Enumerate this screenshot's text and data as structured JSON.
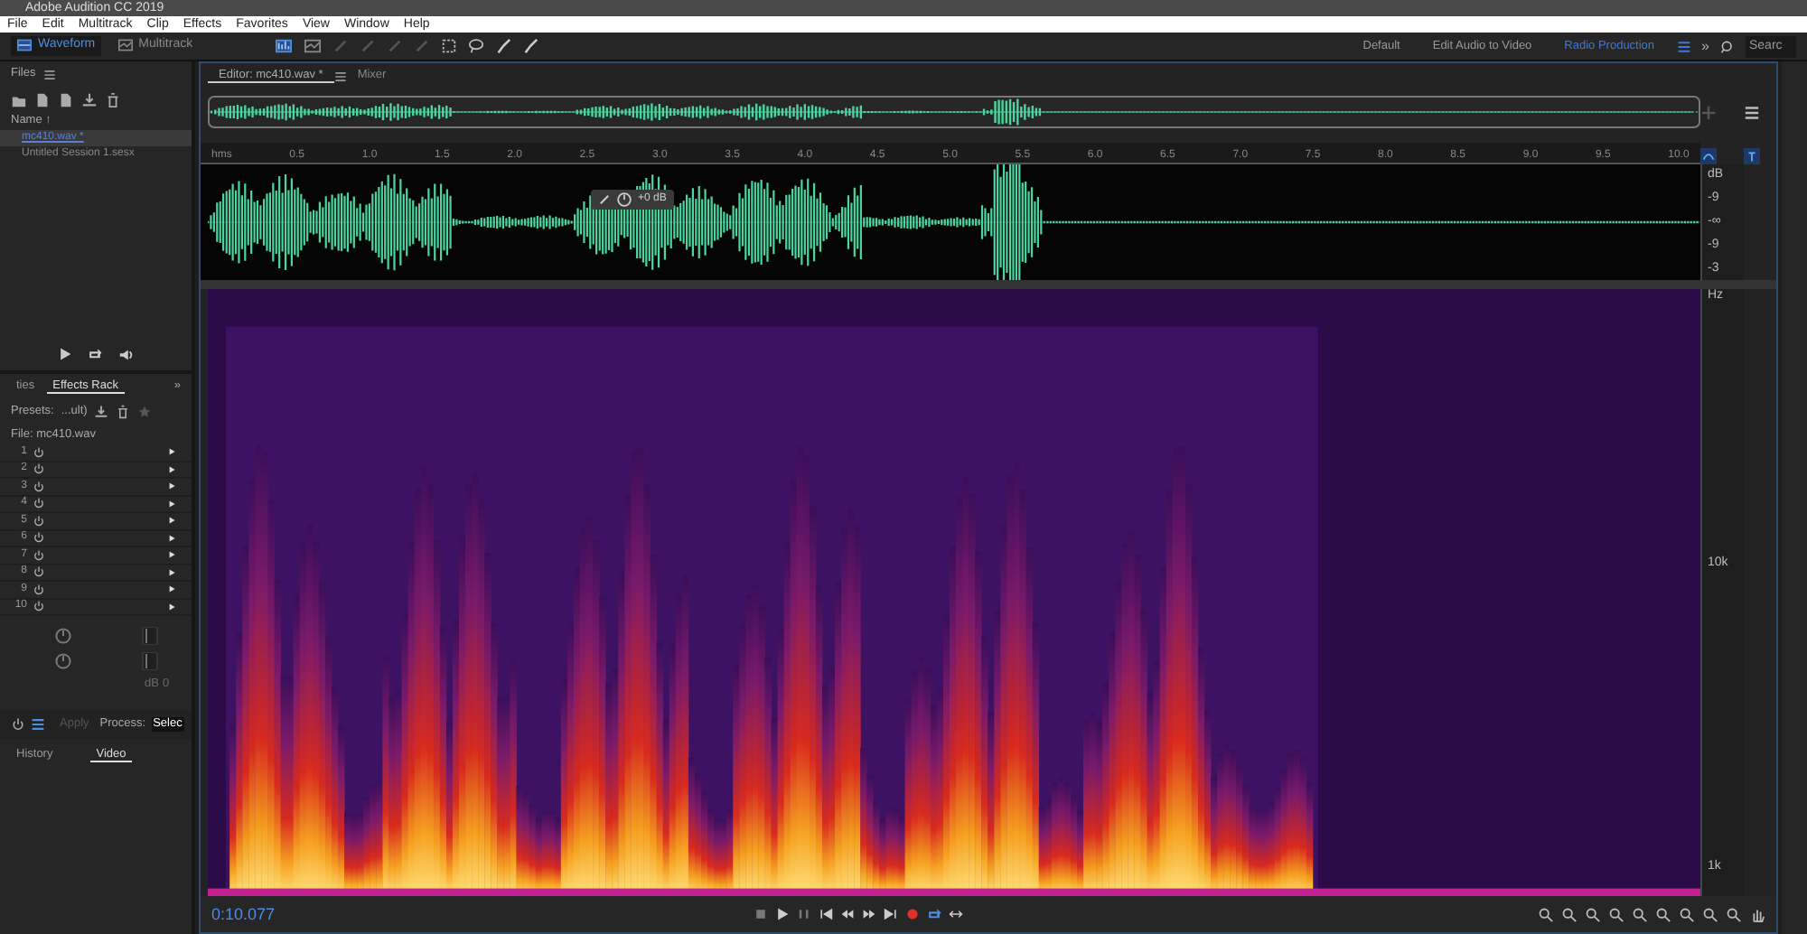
{
  "window": {
    "title": "Adobe Audition CC 2019"
  },
  "menu": [
    "File",
    "Edit",
    "Multitrack",
    "Clip",
    "Effects",
    "Favorites",
    "View",
    "Window",
    "Help"
  ],
  "toolbar": {
    "modes": [
      {
        "label": "Waveform",
        "selected": true
      },
      {
        "label": "Multitrack",
        "selected": false
      }
    ],
    "workspaces": [
      {
        "label": "Default",
        "selected": false
      },
      {
        "label": "Edit Audio to Video",
        "selected": false
      },
      {
        "label": "Radio Production",
        "selected": true
      }
    ],
    "more": "»",
    "search": {
      "placeholder": "Searc"
    }
  },
  "files_panel": {
    "title": "Files",
    "sort_header": "Name ↑",
    "items": [
      {
        "label": "mc410.wav *",
        "selected": true
      },
      {
        "label": "Untitled Session 1.sesx",
        "selected": false
      }
    ]
  },
  "effects_panel": {
    "tabs": [
      {
        "label": "ties",
        "selected": false
      },
      {
        "label": "Effects Rack",
        "selected": true
      }
    ],
    "more": "»",
    "presets_label": "Presets:",
    "preset_value": "...ult)",
    "file_label": "File: mc410.wav",
    "slots": [
      "1",
      "2",
      "3",
      "4",
      "5",
      "6",
      "7",
      "8",
      "9",
      "10"
    ],
    "meter_unit": "dB",
    "meter_value": "0",
    "apply": {
      "label": "Apply",
      "disabled": true
    },
    "process_label": "Process:",
    "process_value": "Selec"
  },
  "bottom_panel": {
    "tabs": [
      {
        "label": "History",
        "selected": false
      },
      {
        "label": "Video",
        "selected": true
      }
    ]
  },
  "editor": {
    "tabs": [
      {
        "label": "Editor: mc410.wav *",
        "selected": true
      },
      {
        "label": "Mixer",
        "selected": false
      }
    ],
    "time_ruler": [
      "hms",
      "0.5",
      "1.0",
      "1.5",
      "2.0",
      "2.5",
      "3.0",
      "3.5",
      "4.0",
      "4.5",
      "5.0",
      "5.5",
      "6.0",
      "6.5",
      "7.0",
      "7.5",
      "8.0",
      "8.5",
      "9.0",
      "9.5",
      "10.0"
    ],
    "hud_gain": "+0 dB",
    "db_ruler": [
      "dB",
      "-9",
      "-∞",
      "-9",
      "-3"
    ],
    "hz_ruler": [
      "Hz",
      "10k",
      "1k"
    ],
    "current_time": "0:10.077"
  }
}
